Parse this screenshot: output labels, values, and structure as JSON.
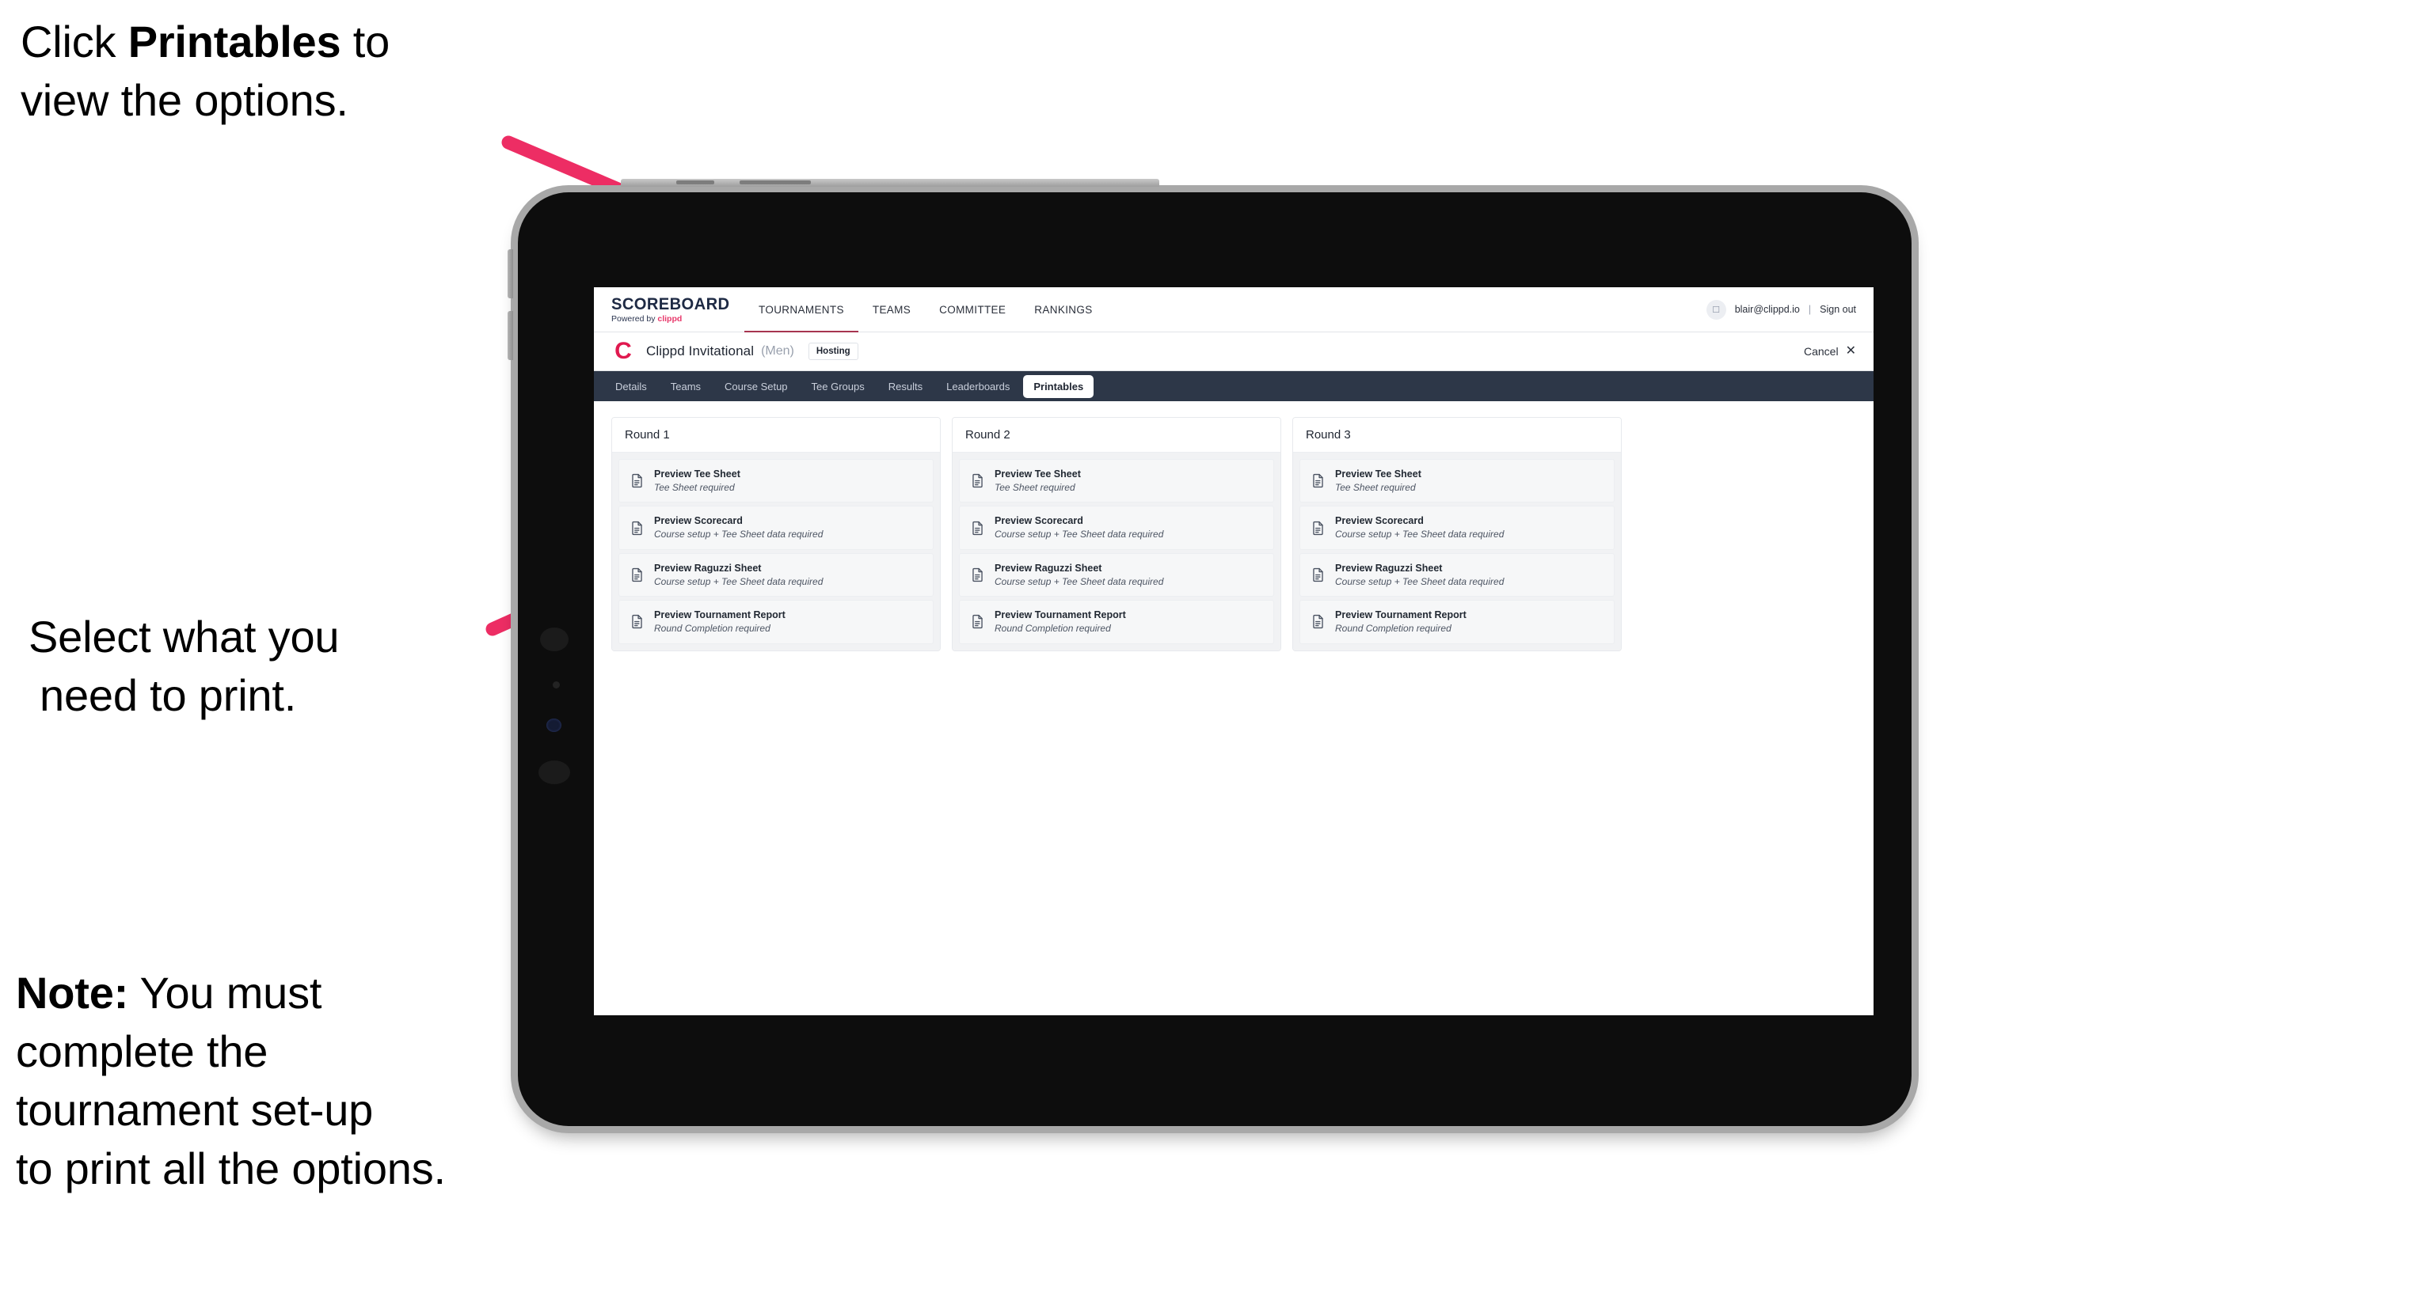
{
  "annotations": [
    {
      "id": "annot-1",
      "lines": [
        [
          {
            "t": "Click ",
            "b": false
          },
          {
            "t": "Printables",
            "b": true
          },
          {
            "t": " to",
            "b": false
          }
        ],
        [
          {
            "t": "view the options.",
            "b": false
          }
        ]
      ]
    },
    {
      "id": "annot-2",
      "lines": [
        [
          {
            "t": "Select what you",
            "b": false
          }
        ],
        [
          {
            "t": "need to print.",
            "b": false
          }
        ]
      ]
    },
    {
      "id": "annot-3",
      "lines": [
        [
          {
            "t": "Note:",
            "b": true
          },
          {
            "t": " You must",
            "b": false
          }
        ],
        [
          {
            "t": "complete the",
            "b": false
          }
        ],
        [
          {
            "t": "tournament set-up",
            "b": false
          }
        ],
        [
          {
            "t": "to print all the options.",
            "b": false
          }
        ]
      ]
    }
  ],
  "colors": {
    "arrow_pink": "#ED2D64",
    "tabstrip_dark": "#2D3748",
    "brand_pink": "#E8386B",
    "club_logo_red": "#E0194F",
    "active_tab_underline": "#A63450"
  },
  "app": {
    "brand": {
      "title": "SCOREBOARD",
      "powered_prefix": "Powered by ",
      "powered_name": "clippd"
    },
    "topnav": {
      "links": [
        {
          "label": "TOURNAMENTS",
          "active": true
        },
        {
          "label": "TEAMS",
          "active": false
        },
        {
          "label": "COMMITTEE",
          "active": false
        },
        {
          "label": "RANKINGS",
          "active": false
        }
      ],
      "user": {
        "avatar_icon": "user-avatar-icon",
        "email": "blair@clippd.io",
        "separator": "|",
        "sign_out": "Sign out"
      }
    },
    "titlebar": {
      "club_logo_letter": "C",
      "tournament_name": "Clippd Invitational",
      "gender": "(Men)",
      "hosting_badge": "Hosting",
      "cancel_label": "Cancel",
      "cancel_icon": "close-x-icon"
    },
    "tabs": [
      {
        "label": "Details",
        "active": false
      },
      {
        "label": "Teams",
        "active": false
      },
      {
        "label": "Course Setup",
        "active": false
      },
      {
        "label": "Tee Groups",
        "active": false
      },
      {
        "label": "Results",
        "active": false
      },
      {
        "label": "Leaderboards",
        "active": false
      },
      {
        "label": "Printables",
        "active": true
      }
    ],
    "rounds": [
      {
        "header": "Round 1",
        "items": [
          {
            "title": "Preview Tee Sheet",
            "subtitle": "Tee Sheet required",
            "icon": "document-icon"
          },
          {
            "title": "Preview Scorecard",
            "subtitle": "Course setup + Tee Sheet data required",
            "icon": "document-icon"
          },
          {
            "title": "Preview Raguzzi Sheet",
            "subtitle": "Course setup + Tee Sheet data required",
            "icon": "document-icon"
          },
          {
            "title": "Preview Tournament Report",
            "subtitle": "Round Completion required",
            "icon": "document-icon"
          }
        ]
      },
      {
        "header": "Round 2",
        "items": [
          {
            "title": "Preview Tee Sheet",
            "subtitle": "Tee Sheet required",
            "icon": "document-icon"
          },
          {
            "title": "Preview Scorecard",
            "subtitle": "Course setup + Tee Sheet data required",
            "icon": "document-icon"
          },
          {
            "title": "Preview Raguzzi Sheet",
            "subtitle": "Course setup + Tee Sheet data required",
            "icon": "document-icon"
          },
          {
            "title": "Preview Tournament Report",
            "subtitle": "Round Completion required",
            "icon": "document-icon"
          }
        ]
      },
      {
        "header": "Round 3",
        "items": [
          {
            "title": "Preview Tee Sheet",
            "subtitle": "Tee Sheet required",
            "icon": "document-icon"
          },
          {
            "title": "Preview Scorecard",
            "subtitle": "Course setup + Tee Sheet data required",
            "icon": "document-icon"
          },
          {
            "title": "Preview Raguzzi Sheet",
            "subtitle": "Course setup + Tee Sheet data required",
            "icon": "document-icon"
          },
          {
            "title": "Preview Tournament Report",
            "subtitle": "Round Completion required",
            "icon": "document-icon"
          }
        ]
      }
    ]
  }
}
